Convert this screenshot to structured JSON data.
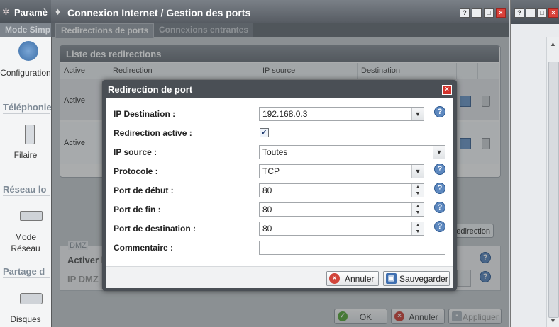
{
  "outer": {
    "title": "Paramè",
    "tab_mode": "Mode Simp",
    "sidebar": {
      "configuration": "Configuration",
      "telephonie": "Téléphonie",
      "filaire": "Filaire",
      "reseau_local": "Réseau lo",
      "mode_reseau_1": "Mode",
      "mode_reseau_2": "Réseau",
      "partage": "Partage d",
      "disques": "Disques"
    }
  },
  "window": {
    "title": "Connexion Internet / Gestion des ports",
    "tabs": [
      {
        "label": "Redirections de ports",
        "active": true
      },
      {
        "label": "Connexions entrantes",
        "active": false
      }
    ],
    "controls": [
      "?",
      "–",
      "□",
      "×"
    ]
  },
  "list": {
    "title": "Liste des redirections",
    "columns": [
      "Active",
      "Redirection",
      "IP source",
      "Destination"
    ],
    "rows": [
      {
        "active": "Active"
      },
      {
        "active": "Active"
      }
    ],
    "add_button_partial": "edirection"
  },
  "dmz": {
    "legend": "DMZ",
    "activer": "Activer l",
    "ip": "IP DMZ"
  },
  "bottom_buttons": {
    "ok": "OK",
    "annuler": "Annuler",
    "appliquer": "Appliquer"
  },
  "modal": {
    "title": "Redirection de port",
    "fields": {
      "ip_destination": {
        "label": "IP Destination :",
        "value": "192.168.0.3"
      },
      "redirection_active": {
        "label": "Redirection active :",
        "checked": true
      },
      "ip_source": {
        "label": "IP source :",
        "value": "Toutes"
      },
      "protocole": {
        "label": "Protocole :",
        "value": "TCP"
      },
      "port_debut": {
        "label": "Port de début :",
        "value": "80"
      },
      "port_fin": {
        "label": "Port de fin :",
        "value": "80"
      },
      "port_destination": {
        "label": "Port de destination :",
        "value": "80"
      },
      "commentaire": {
        "label": "Commentaire :",
        "value": ""
      }
    },
    "buttons": {
      "annuler": "Annuler",
      "sauvegarder": "Sauvegarder"
    }
  },
  "colors": {
    "title_bar": "#575c63",
    "modal_frame": "#4a4f55",
    "help_icon": "#5d88bf",
    "close_red": "#d3322b"
  }
}
